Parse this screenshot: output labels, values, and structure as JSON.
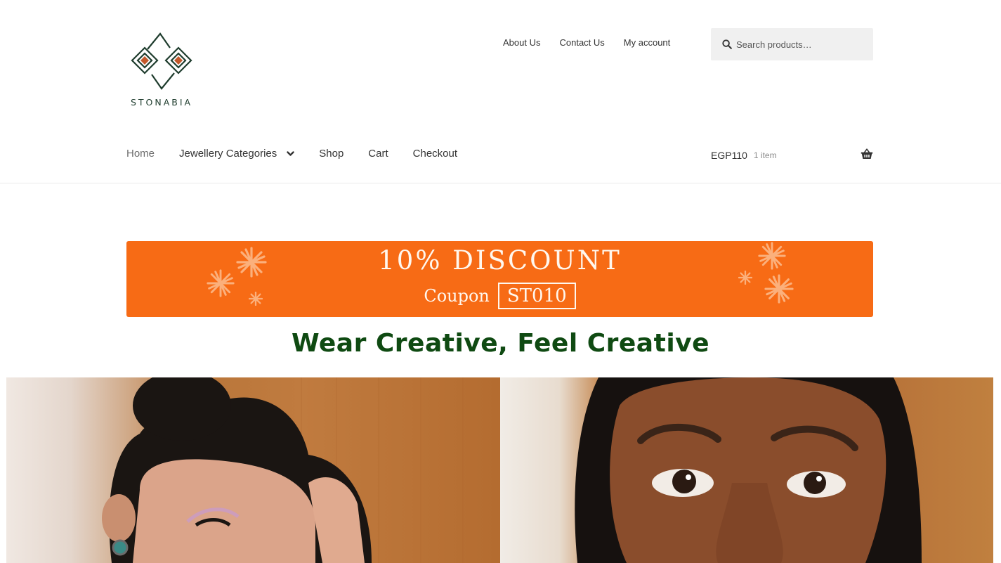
{
  "brand": {
    "name": "STONABIA"
  },
  "top_links": [
    "About Us",
    "Contact Us",
    "My account"
  ],
  "search": {
    "placeholder": "Search products…"
  },
  "nav": {
    "items": [
      "Home",
      "Jewellery Categories",
      "Shop",
      "Cart",
      "Checkout"
    ]
  },
  "cart": {
    "amount": "EGP110",
    "count": "1 item"
  },
  "banner": {
    "title": "10% DISCOUNT",
    "coupon_label": "Coupon",
    "coupon_code": "ST010"
  },
  "tagline": "Wear Creative, Feel Creative",
  "colors": {
    "accent_orange": "#f76b15",
    "brand_green": "#0f4a12",
    "logo_terracotta": "#c4582b"
  },
  "icons": [
    "search-icon",
    "chevron-down-icon",
    "basket-icon"
  ]
}
